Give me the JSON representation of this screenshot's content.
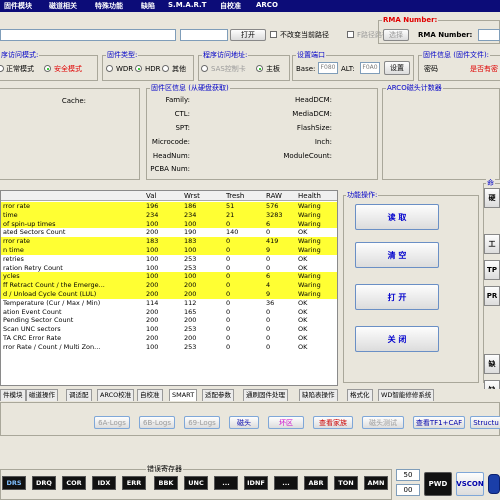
{
  "menu": [
    "固件模块",
    "磁道相关",
    "特殊功能",
    "缺陷",
    "S.M.A.R.T",
    "自校准",
    "ARCO"
  ],
  "toolbar": {
    "open_label": "打开",
    "no_change_path_label": "不改变当前路径",
    "f_path_label": "F路径路径",
    "rma_number_label": "RMA Number:",
    "select_label": "选择",
    "rma_number_field_label": "RMA Number:"
  },
  "access_mode": {
    "title": "序访问模式:",
    "normal_label": "正常模式",
    "safe_label": "安全模式"
  },
  "firmware_type": {
    "title": "固件类型:",
    "wdr": "WDR",
    "hdr": "HDR",
    "other": "其他"
  },
  "program_address": {
    "title": "程序访问地址:",
    "sas_label": "SAS控制卡",
    "mainboard_label": "主板"
  },
  "port": {
    "title": "设置端口",
    "base_label": "Base:",
    "base_value": "F080",
    "alt_label": "ALT:",
    "alt_value": "F0A0",
    "set_label": "设置"
  },
  "fw_file_info": {
    "title": "固件信息 (固件文件):",
    "password_label": "密码",
    "has_password_label": "是否有密"
  },
  "cache_label": "Cache:",
  "fw_area": {
    "title": "固件区信息 (从硬盘获取)",
    "fields_left": [
      "Family:",
      "CTL:",
      "SPT:",
      "Microcode:",
      "HeadNum:",
      "PCBA Num:"
    ],
    "fields_right": [
      "HeadDCM:",
      "MediaDCM:",
      "FlashSize:",
      "Inch:",
      "ModuleCount:"
    ]
  },
  "arco_counter_title": "ARCO磁头计数器",
  "smart_table": {
    "headers": [
      "Val",
      "Wrst",
      "Tresh",
      "RAW",
      "Health"
    ],
    "rows": [
      {
        "name": "rror rate",
        "val": "196",
        "wrst": "186",
        "tresh": "51",
        "raw": "576",
        "health": "Waring",
        "warn": true
      },
      {
        "name": "time",
        "val": "234",
        "wrst": "234",
        "tresh": "21",
        "raw": "3283",
        "health": "Waring",
        "warn": true
      },
      {
        "name": "of spin-up times",
        "val": "100",
        "wrst": "100",
        "tresh": "0",
        "raw": "6",
        "health": "Waring",
        "warn": true
      },
      {
        "name": "ated Sectors Count",
        "val": "200",
        "wrst": "190",
        "tresh": "140",
        "raw": "0",
        "health": "OK",
        "warn": false
      },
      {
        "name": "rror rate",
        "val": "183",
        "wrst": "183",
        "tresh": "0",
        "raw": "419",
        "health": "Waring",
        "warn": true
      },
      {
        "name": "n time",
        "val": "100",
        "wrst": "100",
        "tresh": "0",
        "raw": "9",
        "health": "Waring",
        "warn": true
      },
      {
        "name": "retries",
        "val": "100",
        "wrst": "253",
        "tresh": "0",
        "raw": "0",
        "health": "OK",
        "warn": false
      },
      {
        "name": "ration Retry Count",
        "val": "100",
        "wrst": "253",
        "tresh": "0",
        "raw": "0",
        "health": "OK",
        "warn": false
      },
      {
        "name": "ycles",
        "val": "100",
        "wrst": "100",
        "tresh": "0",
        "raw": "6",
        "health": "Waring",
        "warn": true
      },
      {
        "name": "ff Retract Count / the Emerge...",
        "val": "200",
        "wrst": "200",
        "tresh": "0",
        "raw": "4",
        "health": "Waring",
        "warn": true
      },
      {
        "name": "d / Unload Cycle Count (LUL)",
        "val": "200",
        "wrst": "200",
        "tresh": "0",
        "raw": "9",
        "health": "Waring",
        "warn": true
      },
      {
        "name": "Temperature (Cur / Max / Min)",
        "val": "114",
        "wrst": "112",
        "tresh": "0",
        "raw": "36",
        "health": "OK",
        "warn": false
      },
      {
        "name": "ation Event Count",
        "val": "200",
        "wrst": "165",
        "tresh": "0",
        "raw": "0",
        "health": "OK",
        "warn": false
      },
      {
        "name": "Pending Sector Count",
        "val": "200",
        "wrst": "200",
        "tresh": "0",
        "raw": "0",
        "health": "OK",
        "warn": false
      },
      {
        "name": "Scan UNC sectors",
        "val": "100",
        "wrst": "253",
        "tresh": "0",
        "raw": "0",
        "health": "OK",
        "warn": false
      },
      {
        "name": "TA CRC Error Rate",
        "val": "200",
        "wrst": "200",
        "tresh": "0",
        "raw": "0",
        "health": "OK",
        "warn": false
      },
      {
        "name": "rror Rate / Count / Multi Zon...",
        "val": "100",
        "wrst": "253",
        "tresh": "0",
        "raw": "0",
        "health": "OK",
        "warn": false
      }
    ]
  },
  "function_panel": {
    "title": "功能操作:",
    "read_label": "读 取",
    "clear_label": "清 空",
    "print_label": "打 开",
    "close_label": "关 闭"
  },
  "right_panel": {
    "title": "命",
    "buttons": [
      "硬",
      "工",
      "TP",
      "PR",
      "缺",
      "缺"
    ]
  },
  "tabs": [
    "件模块",
    "磁道操作",
    "调适配",
    "ARCO校准",
    "自校准",
    "SMART",
    "适配参数",
    "通刷固件处理",
    "缺陷表操作",
    "格式化",
    "WD智能修修系统"
  ],
  "logs": {
    "log_6a": "6A-Logs",
    "log_6b": "6B-Logs",
    "log_69": "69-Logs",
    "head": "磁头",
    "bad_track": "坏区",
    "view_family": "查看家族",
    "head_test": "磁头测试",
    "view_tf": "查看TF1+CAF",
    "struct": "Structu"
  },
  "error_register": {
    "title": "错误寄存器",
    "status_bits": [
      "DRS",
      "DRQ",
      "COR",
      "IDX",
      "ERR"
    ],
    "error_bits": [
      "BBK",
      "UNC",
      "...",
      "IDNF",
      "...",
      "ABR",
      "TON",
      "AMN"
    ],
    "value_top": "50",
    "value_bottom": "00",
    "pwd_label": "PWD",
    "vscon_label": "VSCON"
  },
  "colors": {
    "menubar": "#0c0c78",
    "warn_row": "#ffff33",
    "accent_blue": "#0000cc",
    "red": "#e00000"
  }
}
